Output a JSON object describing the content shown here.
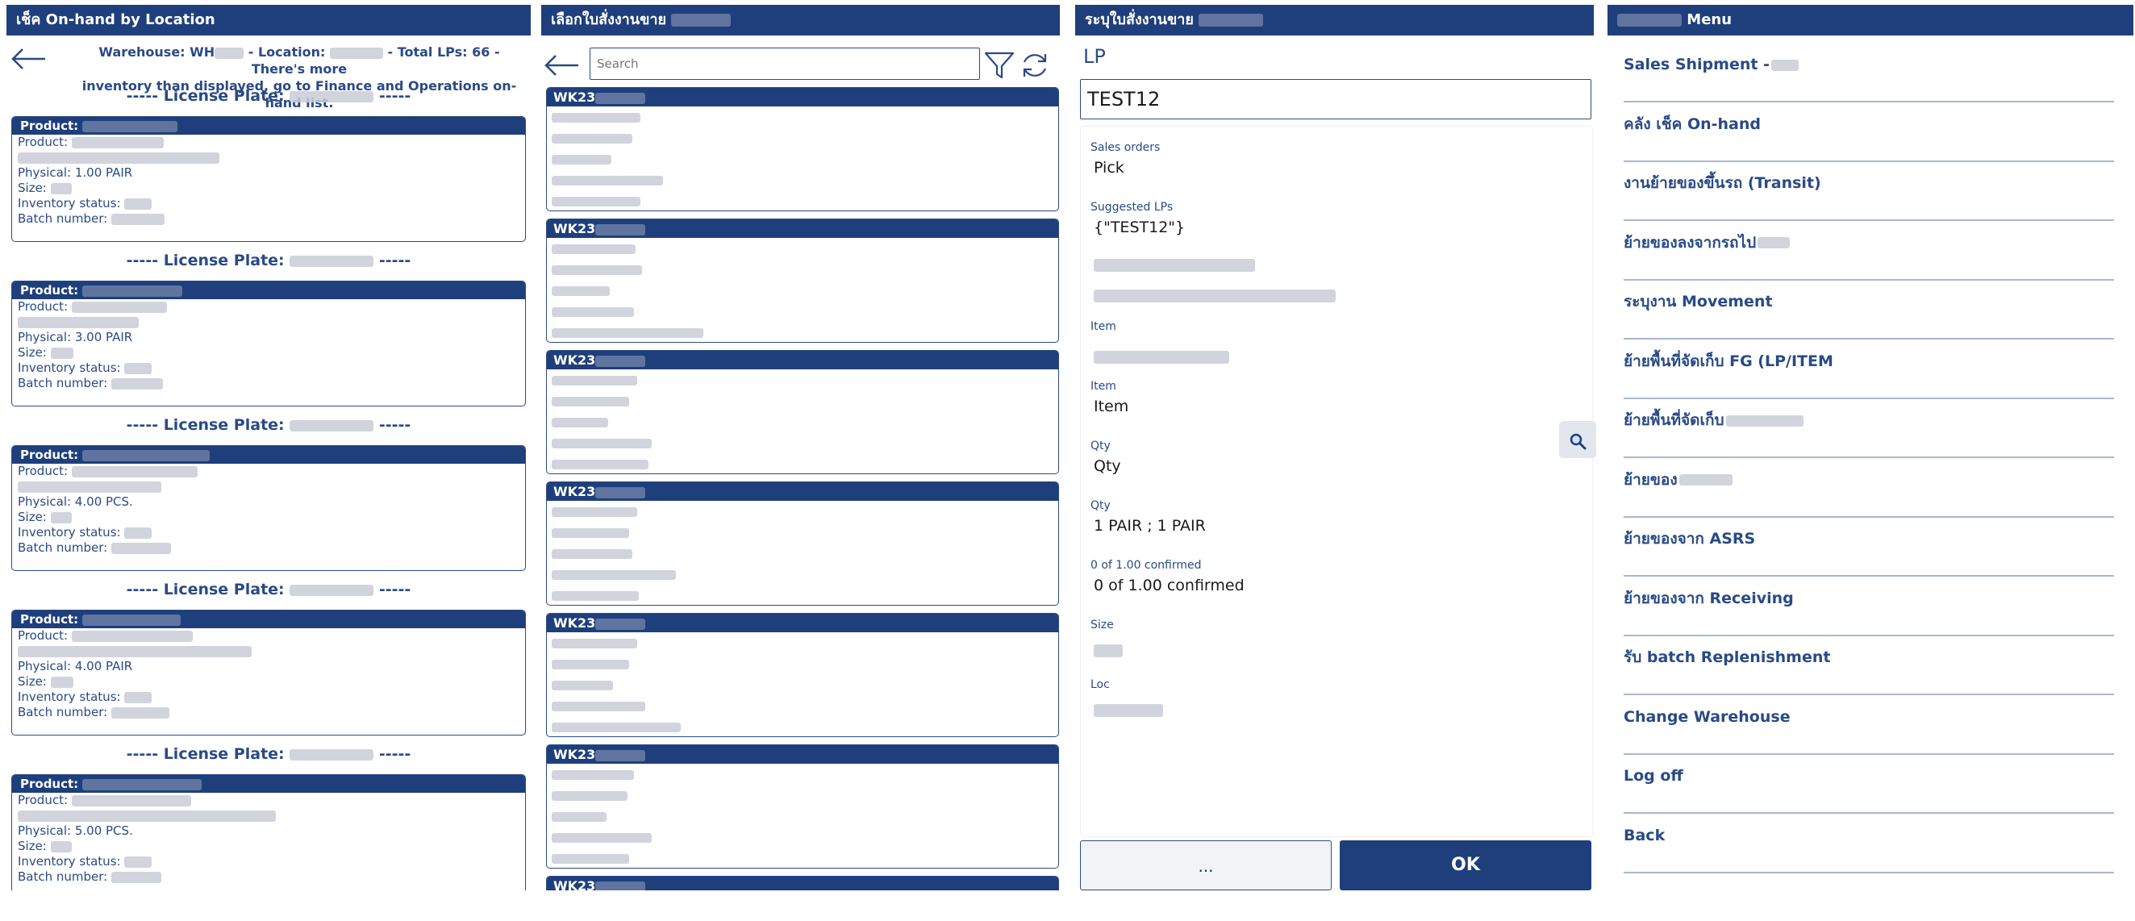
{
  "panel1": {
    "title": "เช็ค On-hand by Location",
    "info_line1_a": "Warehouse: WH",
    "info_line1_b": " - Location: ",
    "info_line1_c": " - Total LPs: 66 - There's more",
    "info_line2": "inventory than displayed, go to Finance and Operations on-hand list.",
    "lp_prefix": "-----  License Plate:",
    "lp_suffix": "-----",
    "cards": [
      {
        "head": "Product:",
        "product": "Product:",
        "physical": "Physical: 1.00 PAIR",
        "size": "Size:",
        "status": "Inventory status:",
        "batch": "Batch number:"
      },
      {
        "head": "Product:",
        "product": "Product:",
        "physical": "Physical: 3.00 PAIR",
        "size": "Size:",
        "status": "Inventory status:",
        "batch": "Batch number:"
      },
      {
        "head": "Product:",
        "product": "Product:",
        "physical": "Physical: 4.00 PCS.",
        "size": "Size:",
        "status": "Inventory status:",
        "batch": "Batch number:"
      },
      {
        "head": "Product:",
        "product": "Product:",
        "physical": "Physical: 4.00 PAIR",
        "size": "Size:",
        "status": "Inventory status:",
        "batch": "Batch number:"
      },
      {
        "head": "Product:",
        "product": "Product:",
        "physical": "Physical: 5.00 PCS.",
        "size": "Size:",
        "status": "Inventory status:",
        "batch": "Batch number:"
      }
    ]
  },
  "panel2": {
    "title": "เลือกใบสั่งงานขาย",
    "search_placeholder": "Search",
    "order_prefix": "WK23"
  },
  "panel3": {
    "title": "ระบุใบสั่งงานขาย",
    "lp_label": "LP",
    "lp_value": "TEST12",
    "sales_orders_label": "Sales orders",
    "sales_orders_value": "Pick",
    "suggested_lps_label": "Suggested LPs",
    "suggested_lps_value": "{\"TEST12\"}",
    "item_label": "Item",
    "item_label2": "Item",
    "item_value2": "Item",
    "qty_label": "Qty",
    "qty_value": "Qty",
    "qty_label2": "Qty",
    "qty_value2": "1 PAIR ; 1 PAIR",
    "confirmed_label": "0 of 1.00 confirmed",
    "confirmed_value": "0 of 1.00 confirmed",
    "size_label": "Size",
    "loc_label": "Loc",
    "more_button": "...",
    "ok_button": "OK"
  },
  "panel4": {
    "title": "Menu",
    "items": [
      "Sales Shipment -",
      "คลัง        เช็ค On-hand",
      "งานย้ายของขึ้นรถ (Transit)",
      "ย้ายของลงจากรถไป",
      "ระบุงาน Movement",
      "ย้ายพื้นที่จัดเก็บ FG (LP/ITEM",
      "ย้ายพื้นที่จัดเก็บ",
      "ย้ายของ",
      "ย้ายของจาก ASRS",
      "ย้ายของจาก Receiving",
      "รับ batch Replenishment",
      "Change Warehouse",
      "Log off",
      "Back"
    ]
  },
  "colors": {
    "header_bg": "#1f3f7c",
    "text_primary": "#2a4a86",
    "border": "#2a4a86"
  },
  "icons": {
    "back": "arrow-left-icon",
    "filter": "filter-icon",
    "refresh": "refresh-icon",
    "zoom": "zoom-icon"
  }
}
